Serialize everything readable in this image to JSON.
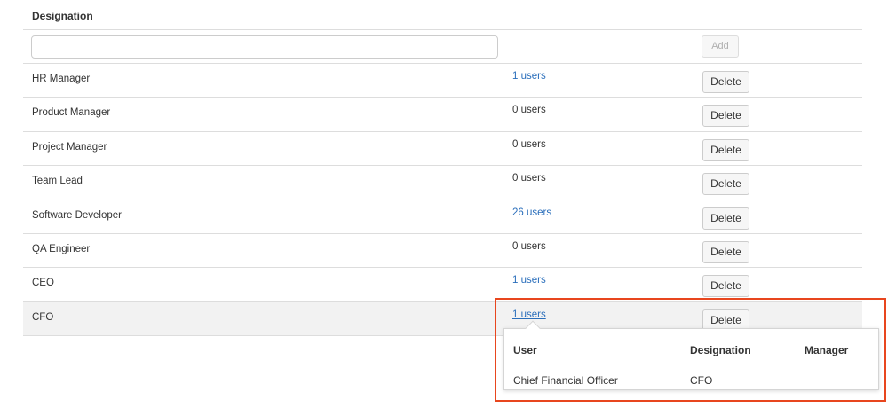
{
  "header": {
    "title": "Designation"
  },
  "add_form": {
    "input_value": "",
    "input_placeholder": "",
    "add_label": "Add"
  },
  "rows": [
    {
      "name": "HR Manager",
      "users": "1 users",
      "delete_label": "Delete"
    },
    {
      "name": "Product Manager",
      "users": "0 users",
      "delete_label": "Delete"
    },
    {
      "name": "Project Manager",
      "users": "0 users",
      "delete_label": "Delete"
    },
    {
      "name": "Team Lead",
      "users": "0 users",
      "delete_label": "Delete"
    },
    {
      "name": "Software Developer",
      "users": "26 users",
      "delete_label": "Delete"
    },
    {
      "name": "QA Engineer",
      "users": "0 users",
      "delete_label": "Delete"
    },
    {
      "name": "CEO",
      "users": "1 users",
      "delete_label": "Delete"
    },
    {
      "name": "CFO",
      "users": "1 users",
      "delete_label": "Delete"
    }
  ],
  "popover": {
    "columns": [
      "User",
      "Designation",
      "Manager"
    ],
    "rows": [
      {
        "user": "Chief Financial Officer",
        "designation": "CFO",
        "manager": ""
      }
    ]
  },
  "colors": {
    "link": "#2a6ebb",
    "highlight": "#e8461e",
    "border": "#dddddd"
  }
}
